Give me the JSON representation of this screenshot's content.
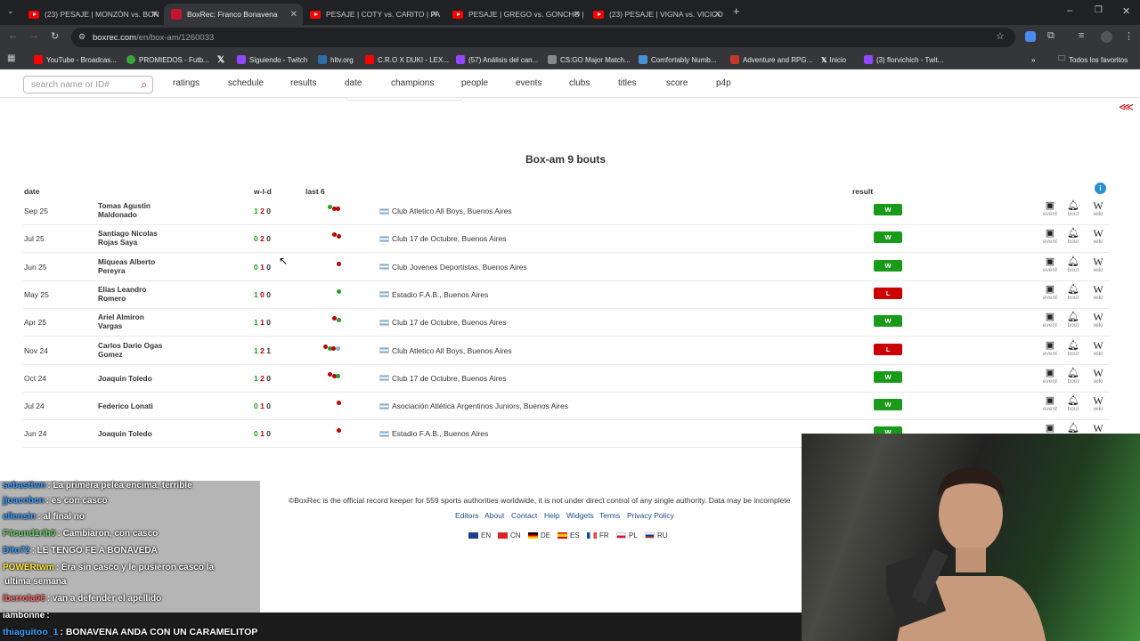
{
  "browser": {
    "tabs": [
      {
        "title": "(23) PESAJE | MONZÓN vs. BON",
        "type": "youtube"
      },
      {
        "title": "BoxRec: Franco Bonavena",
        "type": "boxrec",
        "active": true
      },
      {
        "title": "PESAJE | COTY vs. CARITO | PA",
        "type": "youtube"
      },
      {
        "title": "PESAJE | GREGO vs. GONCHO |",
        "type": "youtube"
      },
      {
        "title": "(23) PESAJE | VIGNA vs. VICICO",
        "type": "youtube"
      }
    ],
    "url_host": "boxrec.com",
    "url_path": "/en/box-am/1260033",
    "bookmarks": [
      {
        "label": "YouTube - Broadcas...",
        "color": "#ff0000"
      },
      {
        "label": "PROMIEDOS - Futb...",
        "color": "#3aa53a"
      },
      {
        "label": "",
        "color": "#000000",
        "icon": "x-icon"
      },
      {
        "label": "Siguiendo - Twitch",
        "color": "#9146ff"
      },
      {
        "label": "hltv.org",
        "color": "#2d6da3"
      },
      {
        "label": "C.R.O X DUKI - LEX...",
        "color": "#ff0000"
      },
      {
        "label": "(57) Análisis del can...",
        "color": "#9146ff"
      },
      {
        "label": "CS:GO Major Match...",
        "color": "#888888"
      },
      {
        "label": "Comfortably Numb...",
        "color": "#4a90d9"
      },
      {
        "label": "Adventure and RPG...",
        "color": "#c0392b"
      },
      {
        "label": "Inicio",
        "color": "#000000"
      },
      {
        "label": "(3) florvichich - Twit...",
        "color": "#9146ff"
      }
    ],
    "all_bookmarks": "Todos los favoritos",
    "more": "»"
  },
  "site": {
    "search_placeholder": "search name or ID#",
    "nav": [
      "ratings",
      "schedule",
      "results",
      "date",
      "champions",
      "people",
      "events",
      "clubs",
      "titles",
      "score",
      "p4p"
    ]
  },
  "table": {
    "heading": "Box-am 9 bouts",
    "headers": {
      "date": "date",
      "wld": "w-l-d",
      "last6": "last 6",
      "result": "result"
    },
    "icon_labels": {
      "event": "event",
      "bout": "bout",
      "wiki": "wiki"
    },
    "rows": [
      {
        "date": "Sep 25",
        "opp1": "Tomas Agustin",
        "opp2": "Maldonado",
        "w": "1",
        "l": "2",
        "d": "0",
        "last6": [
          "#2a9a2a",
          "#c00000",
          "#c00000"
        ],
        "venue": "Club Atletico All Boys, Buenos Aires",
        "result": "W"
      },
      {
        "date": "Jul 25",
        "opp1": "Santiago Nicolas",
        "opp2": "Rojas Saya",
        "w": "0",
        "l": "2",
        "d": "0",
        "last6": [
          "#c00000",
          "#c00000"
        ],
        "venue": "Club 17 de Octubre, Buenos Aires",
        "result": "W"
      },
      {
        "date": "Jun 25",
        "opp1": "Miqueas Alberto",
        "opp2": "Pereyra",
        "w": "0",
        "l": "1",
        "d": "0",
        "last6": [
          "#c00000"
        ],
        "venue": "Club Jovenes Deportistas, Buenos Aires",
        "result": "W"
      },
      {
        "date": "May 25",
        "opp1": "Elias Leandro",
        "opp2": "Romero",
        "w": "1",
        "l": "0",
        "d": "0",
        "last6": [
          "#2a9a2a"
        ],
        "venue": "Estadio F.A.B., Buenos Aires",
        "result": "L"
      },
      {
        "date": "Apr 25",
        "opp1": "Ariel Almiron",
        "opp2": "Vargas",
        "w": "1",
        "l": "1",
        "d": "0",
        "last6": [
          "#c00000",
          "#2a9a2a"
        ],
        "venue": "Club 17 de Octubre, Buenos Aires",
        "result": "W"
      },
      {
        "date": "Nov 24",
        "opp1": "Carlos Dario Ogas",
        "opp2": "Gomez",
        "w": "1",
        "l": "2",
        "d": "1",
        "last6": [
          "#c00000",
          "#2a9a2a",
          "#c00000",
          "#8aaadd"
        ],
        "venue": "Club Atletico All Boys, Buenos Aires",
        "result": "L"
      },
      {
        "date": "Oct 24",
        "opp1": "Joaquin Toledo",
        "opp2": "",
        "w": "1",
        "l": "2",
        "d": "0",
        "last6": [
          "#c00000",
          "#c00000",
          "#2a9a2a"
        ],
        "venue": "Club 17 de Octubre, Buenos Aires",
        "result": "W"
      },
      {
        "date": "Jul 24",
        "opp1": "Federico Lonati",
        "opp2": "",
        "w": "0",
        "l": "1",
        "d": "0",
        "last6": [
          "#c00000"
        ],
        "venue": "Asociación Atlética Argentinos Juniors, Buenos Aires",
        "result": "W"
      },
      {
        "date": "Jun 24",
        "opp1": "Joaquin Toledo",
        "opp2": "",
        "w": "0",
        "l": "1",
        "d": "0",
        "last6": [
          "#c00000"
        ],
        "venue": "Estadio F.A.B., Buenos Aires",
        "result": "W"
      }
    ]
  },
  "footer": {
    "text": "©BoxRec is the official record keeper for 559 sports authorities worldwide, it is not under direct control of any single authority. Data may be incomplete",
    "links": [
      "Editors",
      "About",
      "Contact",
      "Help",
      "Widgets",
      "Terms",
      "Privacy Policy"
    ],
    "languages": [
      "EN",
      "CN",
      "DE",
      "ES",
      "FR",
      "PL",
      "RU"
    ]
  },
  "chat": {
    "messages": [
      {
        "user": "sebastiwn",
        "text": ": La primera pelea encima, terrible",
        "color": "#3aa0ff"
      },
      {
        "user": "jjoacobcn",
        "text": ": es con casco",
        "color": "#3aa0ff"
      },
      {
        "user": "ellensin",
        "text": ": al final no",
        "color": "#3aa0ff"
      },
      {
        "user": "F4cund1rih0",
        "text": ": Cambiaron, con casco",
        "color": "#6fd36f"
      },
      {
        "user": "Dito72",
        "text": ": LE TENGO FE A BONAVEDA",
        "color": "#3aa0ff"
      },
      {
        "user": "POWERtwm",
        "text": ": Era sin casco y le pusieron casco la",
        "color": "#ffea3a"
      },
      {
        "user": "",
        "text": "ultima semana",
        "color": "#ffffff"
      },
      {
        "user": "iberrola06",
        "text": ": van a defender el apellido",
        "color": "#ff6a6a"
      },
      {
        "user": "iambonne",
        "text": ":",
        "color": "#ffffff"
      },
      {
        "user": "thiaguitoo_1",
        "text": ": BONAVENA ANDA CON UN CARAMELITOP",
        "color": "#3aa0ff"
      }
    ]
  }
}
